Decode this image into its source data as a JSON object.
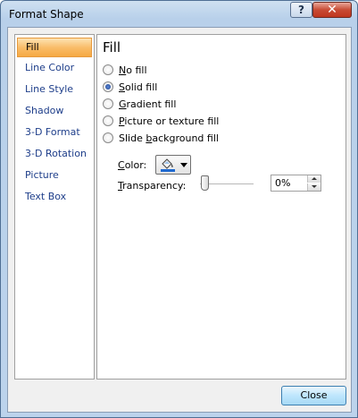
{
  "window": {
    "title": "Format Shape",
    "help_label": "?",
    "close_label": "✕"
  },
  "nav": {
    "items": [
      {
        "label": "Fill",
        "selected": true
      },
      {
        "label": "Line Color"
      },
      {
        "label": "Line Style"
      },
      {
        "label": "Shadow"
      },
      {
        "label": "3-D Format"
      },
      {
        "label": "3-D Rotation"
      },
      {
        "label": "Picture"
      },
      {
        "label": "Text Box"
      }
    ]
  },
  "panel": {
    "title": "Fill",
    "options": [
      {
        "pre": "",
        "key": "N",
        "post": "o fill",
        "checked": false
      },
      {
        "pre": "",
        "key": "S",
        "post": "olid fill",
        "checked": true
      },
      {
        "pre": "",
        "key": "G",
        "post": "radient fill",
        "checked": false
      },
      {
        "pre": "",
        "key": "P",
        "post": "icture or texture fill",
        "checked": false
      },
      {
        "pre": "Slide ",
        "key": "b",
        "post": "ackground fill",
        "checked": false
      }
    ],
    "color": {
      "pre": "",
      "key": "C",
      "post": "olor:",
      "swatch": "#1f6ad0"
    },
    "transparency": {
      "pre": "",
      "key": "T",
      "post": "ransparency:",
      "value": "0%"
    }
  },
  "footer": {
    "close_label": "Close"
  },
  "icons": [
    "help-icon",
    "close-icon",
    "paint-bucket-icon",
    "chevron-down-icon",
    "spin-up-icon",
    "spin-down-icon"
  ]
}
